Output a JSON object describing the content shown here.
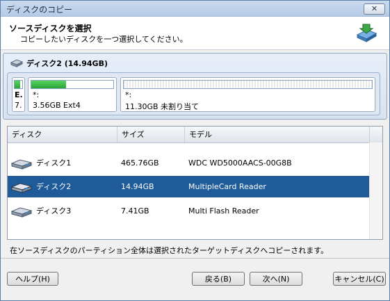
{
  "window": {
    "title": "ディスクのコピー",
    "close_label": "✕"
  },
  "header": {
    "title": "ソースディスクを選択",
    "subtitle": "コピーしたいディスクを一つ選択してください。"
  },
  "disk_map": {
    "disk_label": "ディスク2 (14.94GB)",
    "partitions": [
      {
        "line1": "E.",
        "line2": "7."
      },
      {
        "line1": "*:",
        "line2": "3.56GB Ext4",
        "used_fraction": 0.42
      },
      {
        "line1": "*:",
        "line2": "11.30GB 未割り当て"
      }
    ]
  },
  "table": {
    "columns": [
      "ディスク",
      "サイズ",
      "モデル"
    ],
    "rows": [
      {
        "disk": "ディスク1",
        "size": "465.76GB",
        "model": "WDC WD5000AACS-00G8B"
      },
      {
        "disk": "ディスク2",
        "size": "14.94GB",
        "model": "MultipleCard  Reader"
      },
      {
        "disk": "ディスク3",
        "size": "7.41GB",
        "model": "Multi   Flash Reader"
      }
    ],
    "selected_index": 1
  },
  "info_text": "在ソースディスクのパーティション全体は選択されたターゲットディスクへコピーされます。",
  "buttons": {
    "help": "ヘルプ(H)",
    "back": "戻る(B)",
    "next": "次へ(N)",
    "cancel": "キャンセル(C)"
  },
  "colors": {
    "selection": "#1e5b98",
    "used_fill": "#34b540"
  }
}
